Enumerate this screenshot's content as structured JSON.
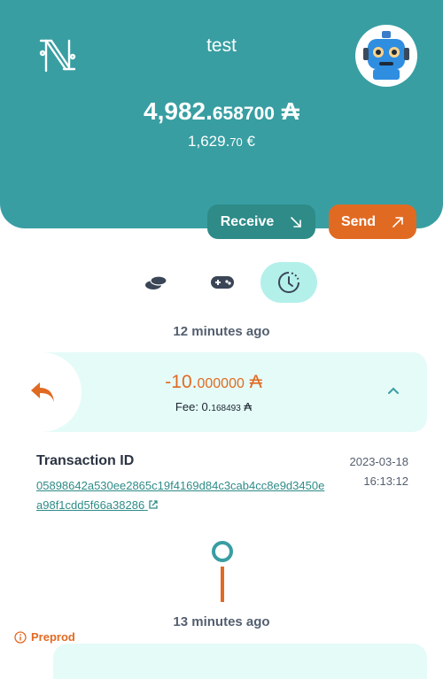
{
  "header": {
    "title": "test",
    "balance": {
      "integer": "4,982.",
      "decimal": "658700",
      "unit": "₳"
    },
    "fiat": {
      "integer": "1,629.",
      "decimal": "70",
      "unit": "€"
    },
    "actions": {
      "receive_label": "Receive",
      "send_label": "Send"
    }
  },
  "tabs": [
    {
      "icon": "coins-icon",
      "active": false
    },
    {
      "icon": "gamepad-icon",
      "active": false
    },
    {
      "icon": "history-clock-icon",
      "active": true
    }
  ],
  "history": [
    {
      "time_ago": "12 minutes ago",
      "amount": {
        "integer": "-10.",
        "decimal": "000000",
        "unit": "₳"
      },
      "fee_label": "Fee: ",
      "fee": {
        "integer": "0.",
        "decimal": "168493",
        "unit": "₳"
      },
      "transaction_label": "Transaction ID",
      "transaction_id": "05898642a530ee2865c19f4169d84c3cab4cc8e9d3450ea98f1cdd5f66a38286",
      "date": "2023-03-18",
      "time": "16:13:12"
    },
    {
      "time_ago": "13 minutes ago"
    }
  ],
  "environment_badge": "Preprod",
  "colors": {
    "primary": "#389ea2",
    "accent": "#e16a22",
    "card": "#e5fbf8"
  }
}
